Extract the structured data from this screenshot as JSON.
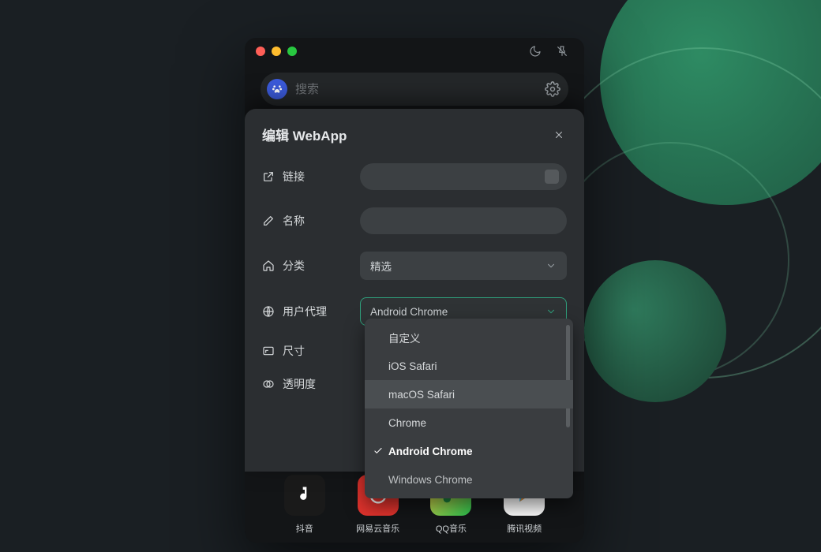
{
  "titlebar": {
    "moon_icon": "moon-icon",
    "pin_icon": "pin-icon"
  },
  "search": {
    "placeholder": "搜索"
  },
  "apps": [
    {
      "label": "抖音"
    },
    {
      "label": "网易云音乐"
    },
    {
      "label": "QQ音乐"
    },
    {
      "label": "腾讯视频"
    }
  ],
  "dialog": {
    "title": "编辑 WebApp",
    "rows": {
      "link_label": "链接",
      "name_label": "名称",
      "category_label": "分类",
      "category_value": "精选",
      "useragent_label": "用户代理",
      "useragent_value": "Android Chrome",
      "size_label": "尺寸",
      "opacity_label": "透明度"
    }
  },
  "useragent_options": [
    {
      "label": "自定义",
      "selected": false,
      "hover": false
    },
    {
      "label": "iOS Safari",
      "selected": false,
      "hover": false
    },
    {
      "label": "macOS Safari",
      "selected": false,
      "hover": true
    },
    {
      "label": "Chrome",
      "selected": false,
      "hover": false
    },
    {
      "label": "Android Chrome",
      "selected": true,
      "hover": false
    },
    {
      "label": "Windows Chrome",
      "selected": false,
      "hover": false
    }
  ]
}
